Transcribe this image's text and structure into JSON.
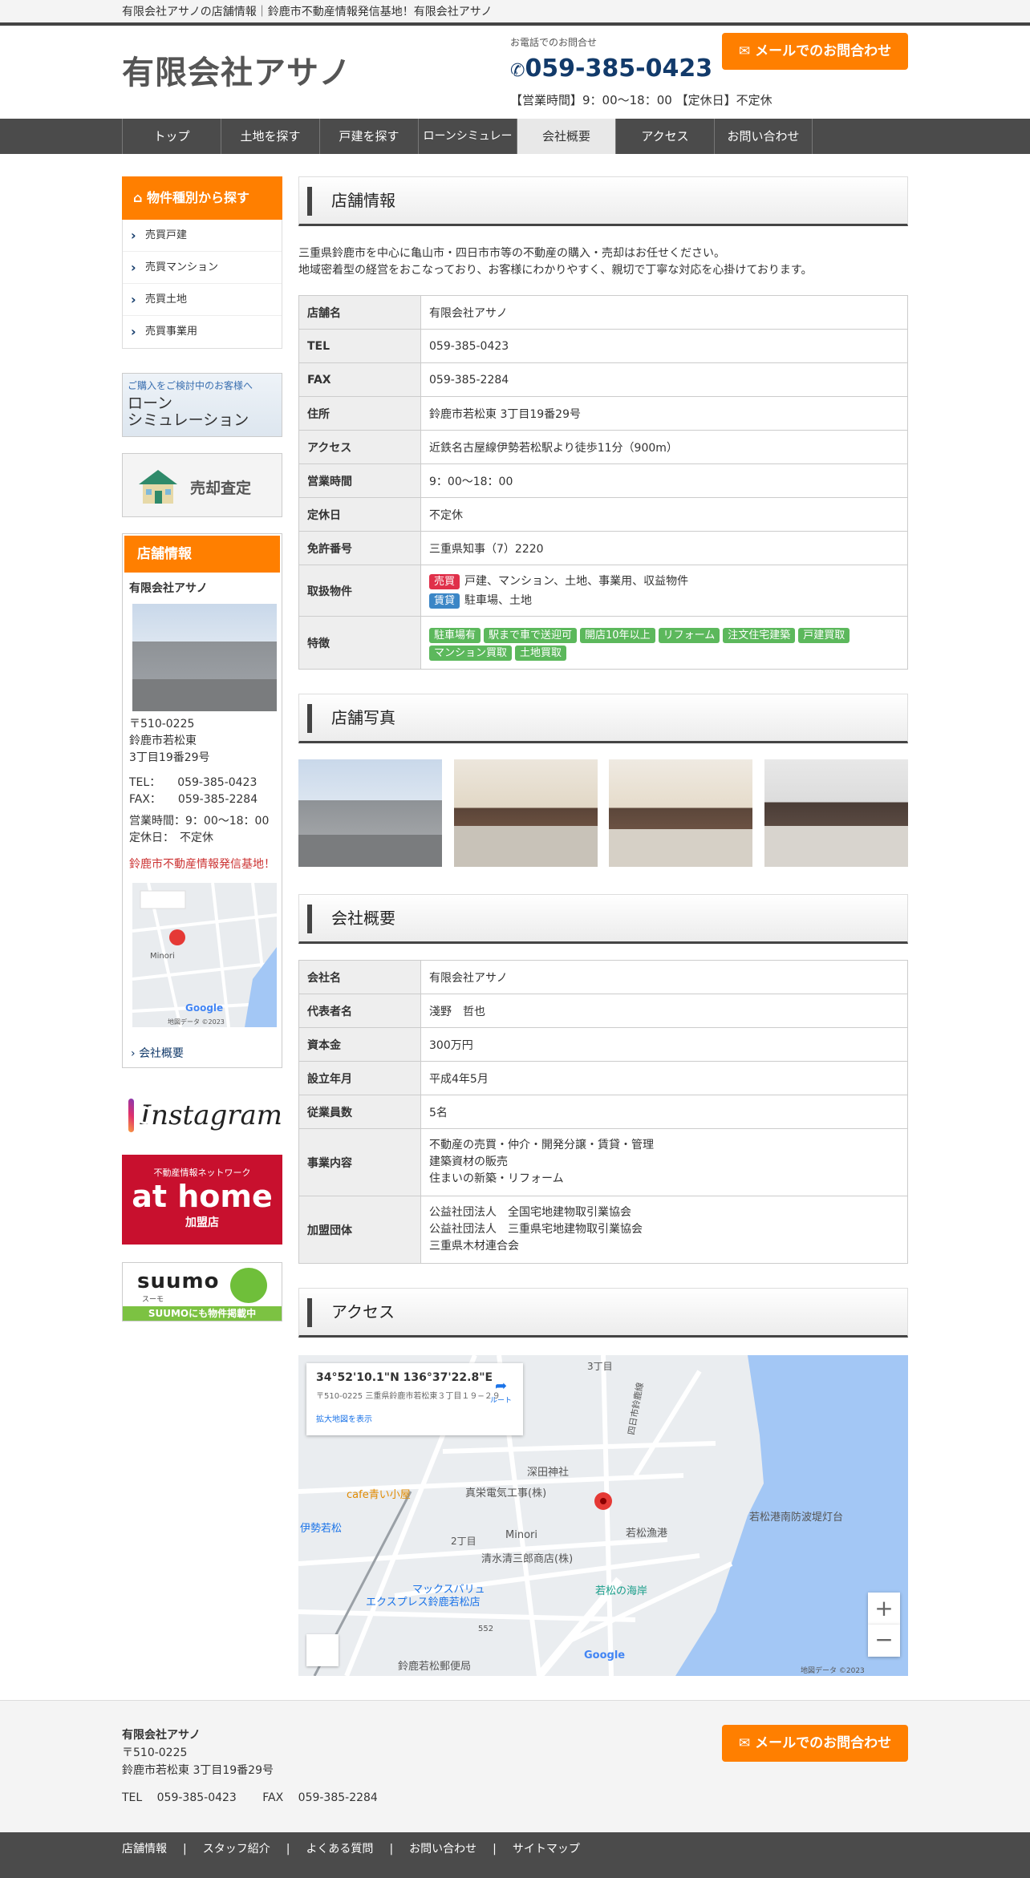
{
  "tagline": "有限会社アサノの店舗情報｜鈴鹿市不動産情報発信基地！有限会社アサノ",
  "header": {
    "logo": "有限会社アサノ",
    "tel_caption": "お電話でのお問合せ",
    "tel": "059-385-0423",
    "hours": "【営業時間】9：00〜18：00 【定休日】不定休",
    "mail_button": "メールでのお問合わせ"
  },
  "nav": [
    "トップ",
    "土地を探す",
    "戸建を探す",
    "ローンシミュレーション",
    "会社概要",
    "アクセス",
    "お問い合わせ"
  ],
  "sidebar": {
    "category_title": "物件種別から探す",
    "categories": [
      "売買戸建",
      "売買マンション",
      "売買土地",
      "売買事業用"
    ],
    "loan_banner": {
      "small": "ご購入をご検討中のお客様へ",
      "line1": "ローン",
      "line2": "シミュレーション"
    },
    "sell_banner": "売却査定",
    "shop": {
      "title": "店舗情報",
      "name": "有限会社アサノ",
      "zip": "〒510-0225",
      "addr1": "鈴鹿市若松東",
      "addr2": "3丁目19番29号",
      "tel": "TEL：　　059-385-0423",
      "fax": "FAX：　　059-385-2284",
      "hours": "営業時間：9：00〜18：00",
      "holiday": "定休日：　不定休",
      "catch": "鈴鹿市不動産情報発信基地！",
      "map_place": "Minori",
      "map_google": "Google",
      "map_copy": "地図データ ©2023",
      "link": "会社概要"
    },
    "instagram": "Instagram",
    "athome": {
      "top": "不動産情報ネットワーク",
      "logo": "at home",
      "bottom": "加盟店"
    },
    "suumo": {
      "logo": "suumo",
      "sub": "スーモ",
      "bar": "SUUMOにも物件掲載中"
    }
  },
  "store": {
    "title": "店舗情報",
    "intro1": "三重県鈴鹿市を中心に亀山市・四日市市等の不動産の購入・売却はお任せください。",
    "intro2": "地域密着型の経営をおこなっており、お客様にわかりやすく、親切で丁寧な対応を心掛けております。",
    "rows": [
      {
        "label": "店舗名",
        "value": "有限会社アサノ"
      },
      {
        "label": "TEL",
        "value": "059-385-0423"
      },
      {
        "label": "FAX",
        "value": "059-385-2284"
      },
      {
        "label": "住所",
        "value": "鈴鹿市若松東 3丁目19番29号"
      },
      {
        "label": "アクセス",
        "value": "近鉄名古屋線伊勢若松駅より徒歩11分（900m）"
      },
      {
        "label": "営業時間",
        "value": "9：00〜18：00"
      },
      {
        "label": "定休日",
        "value": "不定休"
      },
      {
        "label": "免許番号",
        "value": "三重県知事（7）2220"
      }
    ],
    "handling_label": "取扱物件",
    "handling": [
      {
        "tag": "売買",
        "text": "戸建、マンション、土地、事業用、収益物件"
      },
      {
        "tag": "賃貸",
        "text": "駐車場、土地"
      }
    ],
    "features_label": "特徴",
    "features": [
      "駐車場有",
      "駅まで車で送迎可",
      "開店10年以上",
      "リフォーム",
      "注文住宅建築",
      "戸建買取",
      "マンション買取",
      "土地買取"
    ]
  },
  "photos_title": "店舗写真",
  "company": {
    "title": "会社概要",
    "rows": [
      {
        "label": "会社名",
        "lines": [
          "有限会社アサノ"
        ]
      },
      {
        "label": "代表者名",
        "lines": [
          "淺野　哲也"
        ]
      },
      {
        "label": "資本金",
        "lines": [
          "300万円"
        ]
      },
      {
        "label": "設立年月",
        "lines": [
          "平成4年5月"
        ]
      },
      {
        "label": "従業員数",
        "lines": [
          "5名"
        ]
      },
      {
        "label": "事業内容",
        "lines": [
          "不動産の売買・仲介・開発分譲・賃貸・管理",
          "建築資材の販売",
          "住まいの新築・リフォーム"
        ]
      },
      {
        "label": "加盟団体",
        "lines": [
          "公益社団法人　全国宅地建物取引業協会",
          "公益社団法人　三重県宅地建物取引業協会",
          "三重県木材連合会"
        ]
      }
    ]
  },
  "access": {
    "title": "アクセス",
    "coord": "34°52'10.1\"N 136°37'22.8\"E",
    "addr": "〒510-0225 三重県鈴鹿市若松東３丁目１９−２９",
    "larger_map": "拡大地図を表示",
    "route": "ルート",
    "zoom_in": "+",
    "zoom_out": "−",
    "google": "Google",
    "copyright": "地図データ ©2023",
    "labels": [
      "3丁目",
      "深田神社",
      "cafe青い小屋",
      "真栄電気工事(株)",
      "伊勢若松",
      "2丁目",
      "Minori",
      "若松漁港",
      "若松港南防波堤灯台",
      "清水清三郎商店(株)",
      "マックスバリュ",
      "エクスプレス鈴鹿若松店",
      "若松の海岸",
      "552",
      "鈴鹿若松郵便局",
      "四日市鈴鹿線"
    ]
  },
  "footer": {
    "name": "有限会社アサノ",
    "zip": "〒510-0225",
    "addr": "鈴鹿市若松東 3丁目19番29号",
    "tel": "TEL　 059-385-0423　　 FAX　 059-385-2284",
    "mail_button": "メールでのお問合わせ",
    "links": [
      "店舗情報",
      "スタッフ紹介",
      "よくある質問",
      "お問い合わせ",
      "サイトマップ"
    ]
  }
}
